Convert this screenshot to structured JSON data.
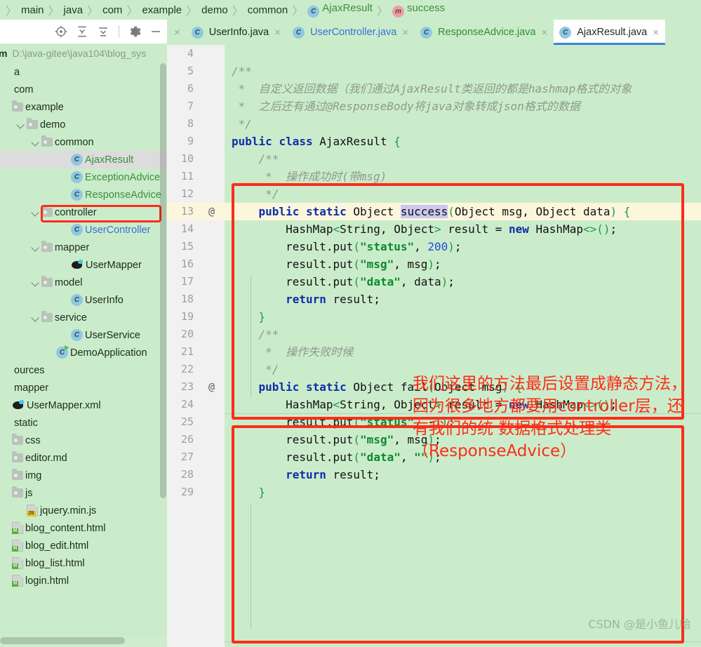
{
  "breadcrumb": {
    "items": [
      {
        "label": "main",
        "style": "dark",
        "icon": ""
      },
      {
        "label": "java",
        "style": "dark",
        "icon": ""
      },
      {
        "label": "com",
        "style": "dark",
        "icon": ""
      },
      {
        "label": "example",
        "style": "dark",
        "icon": ""
      },
      {
        "label": "demo",
        "style": "dark",
        "icon": ""
      },
      {
        "label": "common",
        "style": "dark",
        "icon": ""
      },
      {
        "label": "AjaxResult",
        "style": "green",
        "icon": "class-icon"
      },
      {
        "label": "success",
        "style": "green",
        "icon": "method-icon"
      }
    ],
    "separator": "〉"
  },
  "toolbar": {
    "locate_label": "select-opened-file",
    "collapse_label": "expand-all",
    "expand_label": "collapse-all",
    "settings_label": "settings",
    "hide_label": "hide"
  },
  "project": {
    "name": "m",
    "path": "D:\\java-gitee\\java104\\blog_sys",
    "tree": [
      {
        "label": "a",
        "indent": 0,
        "kind": "text",
        "arrow": "none",
        "style": "dark",
        "selected": false
      },
      {
        "label": "com",
        "indent": 0,
        "kind": "text",
        "arrow": "none",
        "style": "dark",
        "selected": false
      },
      {
        "label": "example",
        "indent": 0,
        "kind": "folder",
        "arrow": "none",
        "style": "dark",
        "selected": false
      },
      {
        "label": "demo",
        "indent": 1,
        "kind": "folder",
        "arrow": "open",
        "style": "dark",
        "selected": false
      },
      {
        "label": "common",
        "indent": 2,
        "kind": "folder",
        "arrow": "open",
        "style": "dark",
        "selected": false
      },
      {
        "label": "AjaxResult",
        "indent": 4,
        "kind": "class",
        "arrow": "none",
        "style": "green",
        "selected": true
      },
      {
        "label": "ExceptionAdvice",
        "indent": 4,
        "kind": "class",
        "arrow": "none",
        "style": "green",
        "selected": false
      },
      {
        "label": "ResponseAdvice",
        "indent": 4,
        "kind": "class",
        "arrow": "none",
        "style": "green",
        "selected": false
      },
      {
        "label": "controller",
        "indent": 2,
        "kind": "folder",
        "arrow": "open",
        "style": "dark",
        "selected": false
      },
      {
        "label": "UserController",
        "indent": 4,
        "kind": "class",
        "arrow": "none",
        "style": "blue",
        "selected": false
      },
      {
        "label": "mapper",
        "indent": 2,
        "kind": "folder",
        "arrow": "open",
        "style": "dark",
        "selected": false
      },
      {
        "label": "UserMapper",
        "indent": 4,
        "kind": "xml",
        "arrow": "none",
        "style": "dark",
        "selected": false
      },
      {
        "label": "model",
        "indent": 2,
        "kind": "folder",
        "arrow": "open",
        "style": "dark",
        "selected": false
      },
      {
        "label": "UserInfo",
        "indent": 4,
        "kind": "class",
        "arrow": "none",
        "style": "dark",
        "selected": false
      },
      {
        "label": "service",
        "indent": 2,
        "kind": "folder",
        "arrow": "open",
        "style": "dark",
        "selected": false
      },
      {
        "label": "UserService",
        "indent": 4,
        "kind": "class",
        "arrow": "none",
        "style": "dark",
        "selected": false
      },
      {
        "label": "DemoApplication",
        "indent": 3,
        "kind": "app",
        "arrow": "none",
        "style": "dark",
        "selected": false
      },
      {
        "label": "ources",
        "indent": 0,
        "kind": "text",
        "arrow": "none",
        "style": "dark",
        "selected": false
      },
      {
        "label": "mapper",
        "indent": 0,
        "kind": "text",
        "arrow": "none",
        "style": "dark",
        "selected": false
      },
      {
        "label": "UserMapper.xml",
        "indent": 0,
        "kind": "xml",
        "arrow": "none",
        "style": "dark",
        "selected": false
      },
      {
        "label": "static",
        "indent": 0,
        "kind": "text",
        "arrow": "none",
        "style": "dark",
        "selected": false
      },
      {
        "label": "css",
        "indent": 0,
        "kind": "folder",
        "arrow": "none",
        "style": "dark",
        "selected": false
      },
      {
        "label": "editor.md",
        "indent": 0,
        "kind": "folder",
        "arrow": "none",
        "style": "dark",
        "selected": false
      },
      {
        "label": "img",
        "indent": 0,
        "kind": "folder",
        "arrow": "none",
        "style": "dark",
        "selected": false
      },
      {
        "label": "js",
        "indent": 0,
        "kind": "folder",
        "arrow": "none",
        "style": "dark",
        "selected": false
      },
      {
        "label": "jquery.min.js",
        "indent": 1,
        "kind": "js",
        "arrow": "none",
        "style": "dark",
        "selected": false
      },
      {
        "label": "blog_content.html",
        "indent": 0,
        "kind": "html",
        "arrow": "none",
        "style": "dark",
        "selected": false
      },
      {
        "label": "blog_edit.html",
        "indent": 0,
        "kind": "html",
        "arrow": "none",
        "style": "dark",
        "selected": false
      },
      {
        "label": "blog_list.html",
        "indent": 0,
        "kind": "html",
        "arrow": "none",
        "style": "dark",
        "selected": false
      },
      {
        "label": "login.html",
        "indent": 0,
        "kind": "html",
        "arrow": "none",
        "style": "dark",
        "selected": false
      }
    ]
  },
  "editor": {
    "tabs": [
      {
        "label": "UserInfo.java",
        "style": "dark",
        "active": false,
        "icon": "class-icon",
        "close": "×"
      },
      {
        "label": "UserController.java",
        "style": "blue",
        "active": false,
        "icon": "class-icon",
        "close": "×"
      },
      {
        "label": "ResponseAdvice.java",
        "style": "green",
        "active": false,
        "icon": "class-icon",
        "close": "×"
      },
      {
        "label": "AjaxResult.java",
        "style": "dark",
        "active": true,
        "icon": "class-icon",
        "close": "×"
      }
    ],
    "first_close": "×",
    "lines": [
      {
        "n": "4",
        "gutter": "",
        "text": "",
        "hl": false
      },
      {
        "n": "5",
        "gutter": "",
        "text": "/**",
        "hl": false
      },
      {
        "n": "6",
        "gutter": "",
        "text": " *  自定义返回数据（我们通过AjaxResult类返回的都是hashmap格式的对象",
        "hl": false
      },
      {
        "n": "7",
        "gutter": "",
        "text": " *  之后还有通过@ResponseBody将java对象转成json格式的数据",
        "hl": false
      },
      {
        "n": "8",
        "gutter": "",
        "text": " */",
        "hl": false
      },
      {
        "n": "9",
        "gutter": "",
        "text": "public class AjaxResult {",
        "hl": false
      },
      {
        "n": "10",
        "gutter": "",
        "text": "    /**",
        "hl": false
      },
      {
        "n": "11",
        "gutter": "",
        "text": "     *  操作成功时(带msg)",
        "hl": false
      },
      {
        "n": "12",
        "gutter": "",
        "text": "     */",
        "hl": false
      },
      {
        "n": "13",
        "gutter": "@",
        "text": "    public static Object success(Object msg, Object data) {",
        "hl": true
      },
      {
        "n": "14",
        "gutter": "",
        "text": "        HashMap<String, Object> result = new HashMap<>();",
        "hl": false
      },
      {
        "n": "15",
        "gutter": "",
        "text": "        result.put(\"status\", 200);",
        "hl": false
      },
      {
        "n": "16",
        "gutter": "",
        "text": "        result.put(\"msg\", msg);",
        "hl": false
      },
      {
        "n": "17",
        "gutter": "",
        "text": "        result.put(\"data\", data);",
        "hl": false
      },
      {
        "n": "18",
        "gutter": "",
        "text": "        return result;",
        "hl": false
      },
      {
        "n": "19",
        "gutter": "",
        "text": "    }",
        "hl": false
      },
      {
        "n": "20",
        "gutter": "",
        "text": "    /**",
        "hl": false
      },
      {
        "n": "21",
        "gutter": "",
        "text": "     *  操作失败时候",
        "hl": false
      },
      {
        "n": "22",
        "gutter": "",
        "text": "     */",
        "hl": false
      },
      {
        "n": "23",
        "gutter": "@",
        "text": "    public static Object fail(Object msg) {",
        "hl": false
      },
      {
        "n": "24",
        "gutter": "",
        "text": "        HashMap<String, Object> result = new HashMap<>();",
        "hl": false
      },
      {
        "n": "25",
        "gutter": "",
        "text": "        result.put(\"status\", -1);",
        "hl": false
      },
      {
        "n": "26",
        "gutter": "",
        "text": "        result.put(\"msg\", msg);",
        "hl": false
      },
      {
        "n": "27",
        "gutter": "",
        "text": "        result.put(\"data\", \"\");",
        "hl": false
      },
      {
        "n": "28",
        "gutter": "",
        "text": "        return result;",
        "hl": false
      },
      {
        "n": "29",
        "gutter": "",
        "text": "    }",
        "hl": false
      }
    ]
  },
  "annotation": {
    "text": "我们这里的方法最后设置成静态方法，因为很多地方都要用controller层，还有我们的统 数据格式处理类（ResponseAdvice）",
    "color": "#fc2d18"
  },
  "watermark": {
    "text": "CSDN @是小鱼儿哈"
  },
  "colors": {
    "background": "#cbeccb",
    "gutter": "#f1f1f1",
    "highlight_row": "#fcf6dd",
    "accent": "#fc2d18",
    "active_tab_underline": "#3a87d8"
  }
}
